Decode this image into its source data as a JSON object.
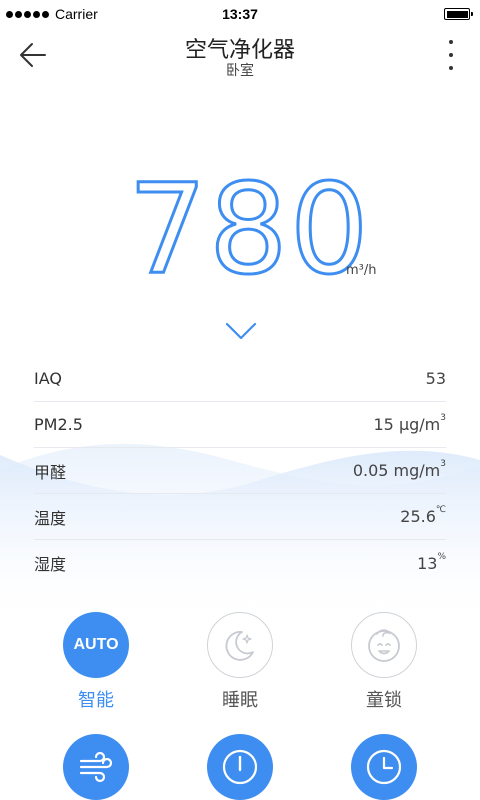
{
  "status_bar": {
    "carrier": "Carrier",
    "time": "13:37"
  },
  "nav": {
    "title": "空气净化器",
    "subtitle": "卧室"
  },
  "airflow": {
    "value": "780",
    "unit": "m³/h"
  },
  "metrics": [
    {
      "label": "IAQ",
      "value": "53",
      "unit": ""
    },
    {
      "label": "PM2.5",
      "value": "15 μg/m",
      "unit": "3"
    },
    {
      "label": "甲醛",
      "value": "0.05 mg/m",
      "unit": "3"
    },
    {
      "label": "温度",
      "value": "25.6",
      "unit": "℃"
    },
    {
      "label": "湿度",
      "value": "13",
      "unit": "%"
    }
  ],
  "controls": {
    "auto": {
      "icon_text": "AUTO",
      "label": "智能"
    },
    "sleep": {
      "label": "睡眠"
    },
    "child_lock": {
      "label": "童锁"
    }
  },
  "colors": {
    "accent": "#3d8ef0",
    "inactive_border": "#cfd3d8",
    "divider": "#e6e9ee"
  },
  "icons": {
    "back": "arrow-left-icon",
    "more": "more-vertical-icon",
    "expand": "chevron-down-icon",
    "sleep": "moon-stars-icon",
    "child_lock": "baby-face-icon",
    "wind": "wind-icon",
    "power": "power-icon",
    "timer": "clock-icon"
  }
}
